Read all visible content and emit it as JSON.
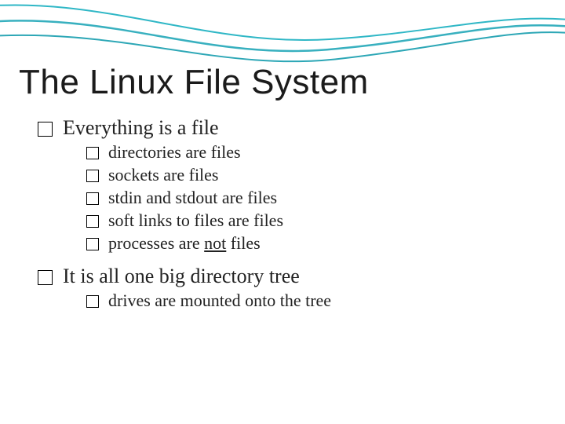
{
  "title": "The Linux File System",
  "bullets": [
    {
      "text": "Everything is a file",
      "children": [
        {
          "text": "directories are files"
        },
        {
          "text": "sockets are files"
        },
        {
          "text": "stdin and stdout are files"
        },
        {
          "text": "soft links to files are files"
        },
        {
          "pre": "processes are ",
          "u": "not",
          "post": " files"
        }
      ]
    },
    {
      "text": "It is all one big directory tree",
      "children": [
        {
          "text": "drives are mounted onto the tree"
        }
      ]
    }
  ]
}
